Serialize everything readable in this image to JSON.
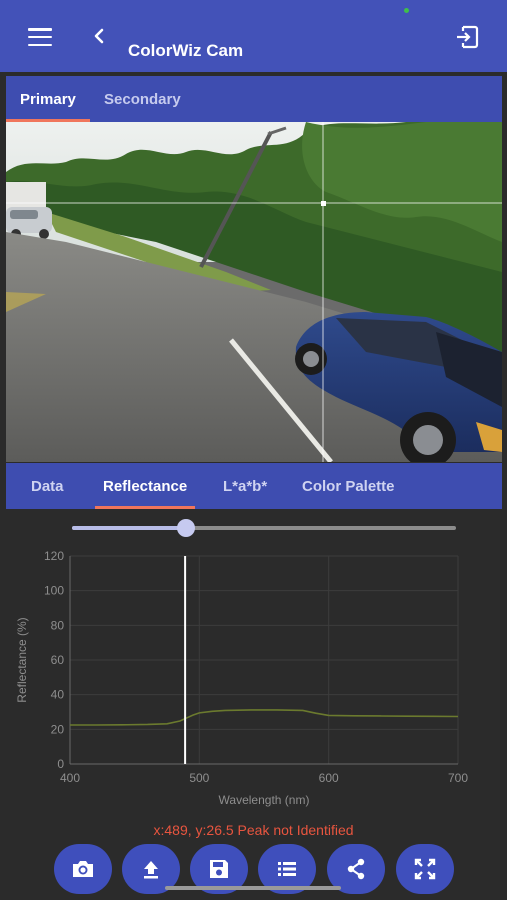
{
  "app_bar": {
    "title": "ColorWiz Cam",
    "menu_icon": "hamburger-menu-icon",
    "back_icon": "chevron-left-icon",
    "exit_icon": "exit-to-app-icon"
  },
  "image_tabs": [
    {
      "label": "Primary",
      "active": true
    },
    {
      "label": "Secondary",
      "active": false
    }
  ],
  "analysis_tabs": [
    {
      "label": "Data",
      "active": false
    },
    {
      "label": "Reflectance",
      "active": true
    },
    {
      "label": "L*a*b*",
      "active": false
    },
    {
      "label": "Color Palette",
      "active": false
    }
  ],
  "wavelength_slider": {
    "value_fraction": 0.297
  },
  "chart_data": {
    "type": "line",
    "xlabel": "Wavelength (nm)",
    "ylabel": "Reflectance (%)",
    "xlim": [
      400,
      700
    ],
    "ylim": [
      0,
      120
    ],
    "x_ticks": [
      "400",
      "500",
      "600",
      "700"
    ],
    "y_ticks": [
      "0",
      "20",
      "40",
      "60",
      "80",
      "100",
      "120"
    ],
    "grid": true,
    "cursor_x": 489,
    "series": [
      {
        "color": "#6b7a2e",
        "x": [
          400,
          420,
          440,
          460,
          475,
          485,
          490,
          495,
          500,
          510,
          520,
          540,
          560,
          580,
          590,
          600,
          620,
          640,
          660,
          680,
          700
        ],
        "y": [
          22.5,
          22.5,
          22.6,
          22.8,
          23.2,
          24.8,
          26.5,
          28.2,
          29.5,
          30.4,
          30.9,
          31.2,
          31.2,
          30.9,
          29.3,
          28.0,
          27.8,
          27.7,
          27.6,
          27.5,
          27.4
        ]
      }
    ]
  },
  "readout": "x:489,  y:26.5 Peak not Identified",
  "actions": [
    {
      "name": "capture-button",
      "icon": "camera-icon"
    },
    {
      "name": "upload-button",
      "icon": "upload-icon"
    },
    {
      "name": "save-button",
      "icon": "save-icon"
    },
    {
      "name": "list-button",
      "icon": "list-icon"
    },
    {
      "name": "share-button",
      "icon": "share-icon"
    },
    {
      "name": "fullscreen-button",
      "icon": "fullscreen-icon"
    }
  ],
  "colors": {
    "primary": "#4352b8",
    "tab_indicator": "#f0765c",
    "readout": "#e8553f",
    "background": "#2b2b2b"
  }
}
